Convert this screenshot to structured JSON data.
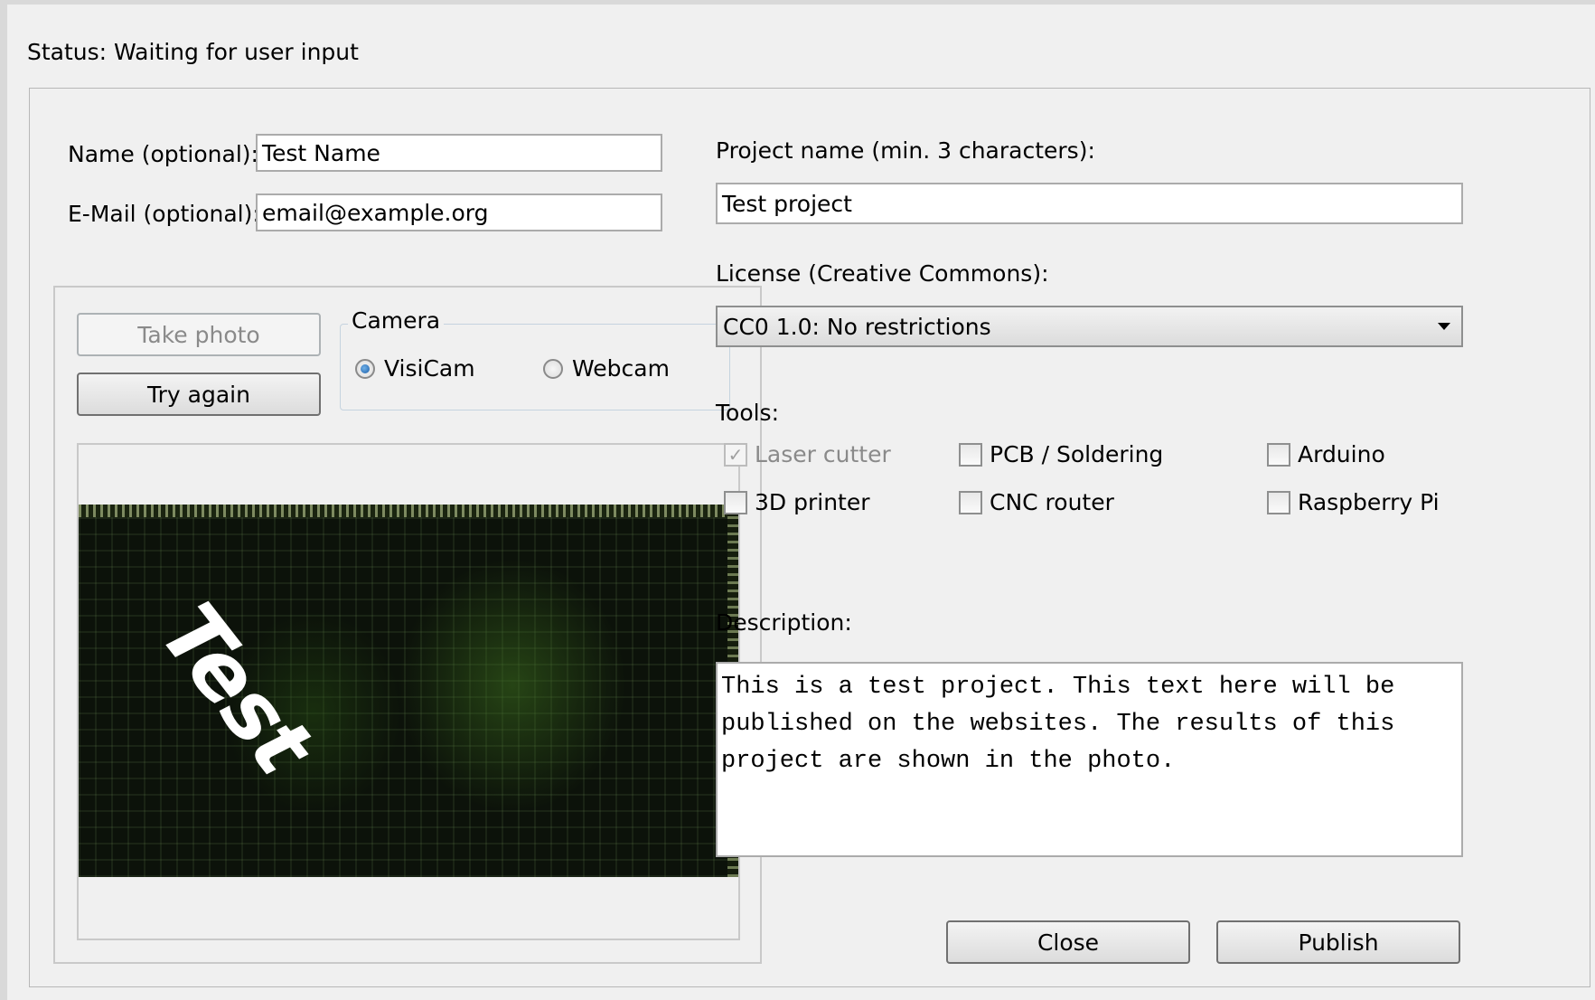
{
  "status": "Status: Waiting for user input",
  "form": {
    "name_label": "Name (optional):",
    "name_value": "Test Name",
    "email_label": "E-Mail (optional):",
    "email_value": "email@example.org",
    "project_label": "Project name (min. 3 characters):",
    "project_value": "Test project",
    "license_label": "License (Creative Commons):",
    "license_value": "CC0 1.0: No restrictions",
    "tools_label": "Tools:",
    "tools": [
      {
        "label": "Laser cutter",
        "checked": true,
        "disabled": true
      },
      {
        "label": "PCB / Soldering",
        "checked": false,
        "disabled": false
      },
      {
        "label": "Arduino",
        "checked": false,
        "disabled": false
      },
      {
        "label": "3D printer",
        "checked": false,
        "disabled": false
      },
      {
        "label": "CNC router",
        "checked": false,
        "disabled": false
      },
      {
        "label": "Raspberry Pi",
        "checked": false,
        "disabled": false
      }
    ],
    "description_label": "Description:",
    "description_value": "This is a test project. This text here will be published on the websites. The results of this project are shown in the photo."
  },
  "camera": {
    "take_photo_label": "Take photo",
    "try_again_label": "Try again",
    "group_title": "Camera",
    "options": [
      {
        "label": "VisiCam",
        "selected": true
      },
      {
        "label": "Webcam",
        "selected": false
      }
    ],
    "photo_text": "Test"
  },
  "buttons": {
    "close_label": "Close",
    "publish_label": "Publish"
  }
}
